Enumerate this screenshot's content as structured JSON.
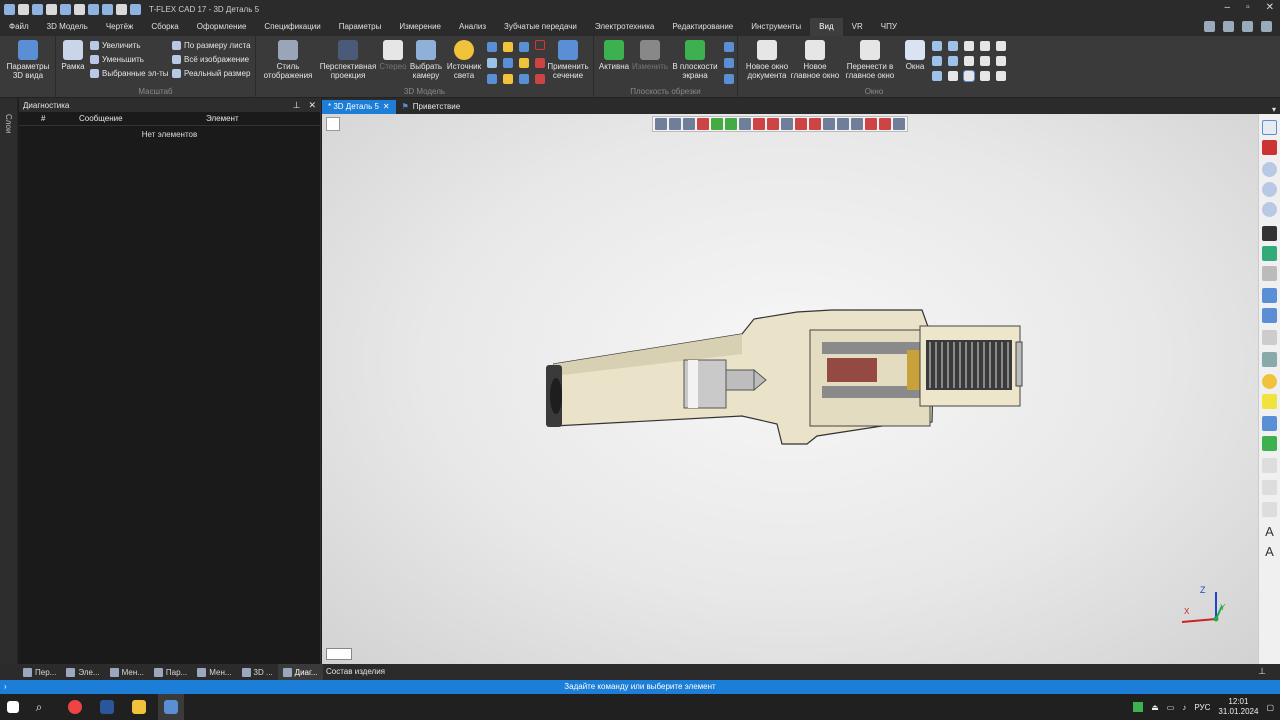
{
  "window": {
    "title": "T-FLEX CAD 17 - 3D Деталь 5"
  },
  "menu": [
    "Файл",
    "3D Модель",
    "Чертёж",
    "Сборка",
    "Оформление",
    "Спецификации",
    "Параметры",
    "Измерение",
    "Анализ",
    "Зубчатые передачи",
    "Электротехника",
    "Редактирование",
    "Инструменты",
    "Вид",
    "VR",
    "ЧПУ"
  ],
  "menu_active": "Вид",
  "ribbon": {
    "params3d": "Параметры 3D вида",
    "frame": "Рамка",
    "zoom_in": "Увеличить",
    "zoom_out": "Уменьшить",
    "selected": "Выбранные эл-ты",
    "fit_sheet": "По размеру листа",
    "all_image": "Всё изображение",
    "real_size": "Реальный размер",
    "group_scale": "Масштаб",
    "display_style": "Стиль отображения",
    "perspective": "Перспективная проекция",
    "stereo": "Стерео",
    "choose_camera": "Выбрать камеру",
    "light": "Источник света",
    "apply_section": "Применить сечение",
    "group_3d": "3D Модель",
    "active": "Активна",
    "change": "Изменить",
    "in_screen_plane": "В плоскости экрана",
    "group_clip": "Плоскость обрезки",
    "new_doc_window": "Новое окно документа",
    "new_main_window": "Новое главное окно",
    "move_to_main": "Перенести в главное окно",
    "windows": "Окна",
    "group_window": "Окно"
  },
  "diagnostics": {
    "title": "Диагностика",
    "col_num": "#",
    "col_msg": "Сообщение",
    "col_elem": "Элемент",
    "empty": "Нет элементов"
  },
  "left_strip": "Слои",
  "tabs": [
    {
      "label": "* 3D Деталь 5"
    },
    {
      "label": "Приветствие"
    }
  ],
  "bottom_tabs": [
    "Пер...",
    "Эле...",
    "Мен...",
    "Пар...",
    "Мен...",
    "3D ...",
    "Диаг..."
  ],
  "composition": "Состав изделия",
  "status": "Задайте команду или выберите элемент",
  "axes": {
    "z": "Z",
    "y": "Y",
    "x": "X"
  },
  "tray": {
    "lang": "РУС",
    "time": "12:01",
    "date": "31.01.2024"
  }
}
